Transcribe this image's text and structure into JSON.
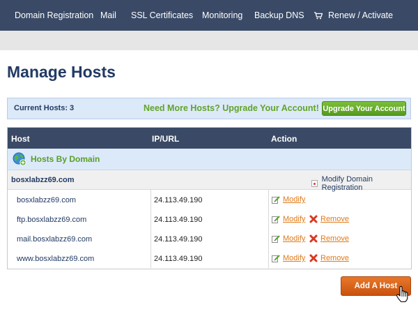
{
  "nav": {
    "items": [
      {
        "label": "Domain Registration"
      },
      {
        "label": "Mail"
      },
      {
        "label": "SSL Certificates"
      },
      {
        "label": "Monitoring"
      },
      {
        "label": "Backup DNS"
      },
      {
        "label": "Renew / Activate",
        "icon": "cart-icon"
      }
    ]
  },
  "page": {
    "title": "Manage Hosts"
  },
  "upgrade": {
    "current_hosts": "Current Hosts: 3",
    "message": "Need More Hosts? Upgrade Your Account!",
    "button_label": "Upgrade Your Account"
  },
  "table": {
    "headers": {
      "host": "Host",
      "ip": "IP/URL",
      "action": "Action"
    },
    "group_title": "Hosts By Domain",
    "domain": "bosxlabzz69.com",
    "modify_domain_label": "Modify Domain Registration",
    "rows": [
      {
        "host": "bosxlabzz69.com",
        "ip": "24.113.49.190",
        "modify": "Modify"
      },
      {
        "host": "ftp.bosxlabzz69.com",
        "ip": "24.113.49.190",
        "modify": "Modify",
        "remove": "Remove"
      },
      {
        "host": "mail.bosxlabzz69.com",
        "ip": "24.113.49.190",
        "modify": "Modify",
        "remove": "Remove"
      },
      {
        "host": "www.bosxlabzz69.com",
        "ip": "24.113.49.190",
        "modify": "Modify",
        "remove": "Remove"
      }
    ]
  },
  "add_host": {
    "label": "Add A Host"
  },
  "colors": {
    "nav": "#3a4a66",
    "title": "#223a63",
    "green": "#62a32a",
    "orange": "#e07a1a",
    "button_orange": "#d9601b"
  }
}
